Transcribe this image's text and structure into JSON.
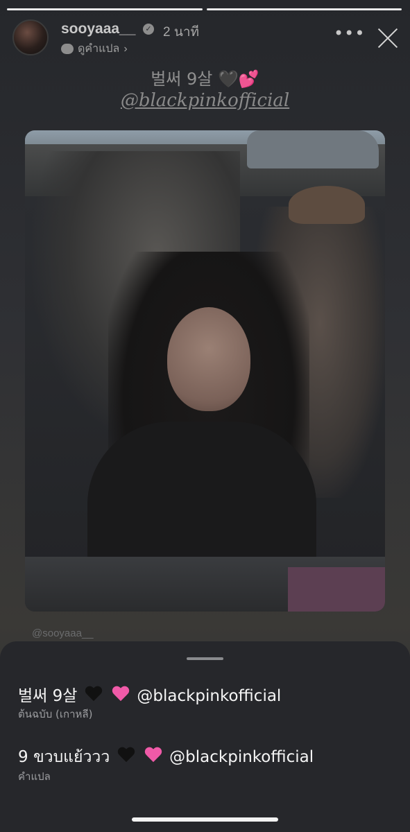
{
  "story": {
    "username": "sooyaaa__",
    "time": "2 นาที",
    "see_translation": "ดูคำแปล",
    "more_icon": "more-dots-icon",
    "close_icon": "close-icon"
  },
  "post": {
    "caption": "벌써 9살 🖤💕",
    "mention": "@blackpinkofficial",
    "watermark": "@sooyaaa__"
  },
  "translation_sheet": {
    "original_text_prefix": "벌써 9살",
    "original_mention": "@blackpinkofficial",
    "original_label": "ต้นฉบับ (เกาหลี)",
    "translated_text_prefix": "9 ขวบแย้ววว",
    "translated_mention": "@blackpinkofficial",
    "translated_label": "คำแปล"
  },
  "colors": {
    "pink_heart": "#f05aa8",
    "black_heart": "#111111"
  }
}
